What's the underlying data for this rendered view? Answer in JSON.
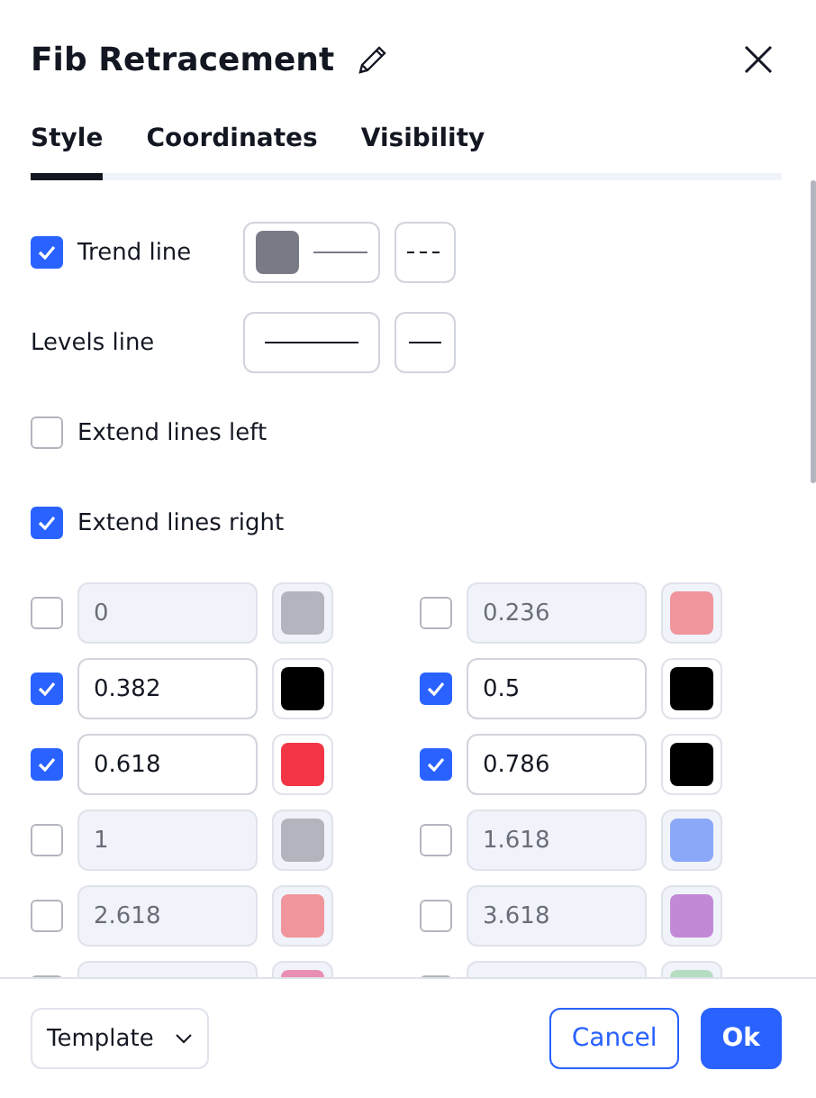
{
  "dialog": {
    "title": "Fib Retracement"
  },
  "tabs": [
    {
      "label": "Style",
      "selected": true
    },
    {
      "label": "Coordinates",
      "selected": false
    },
    {
      "label": "Visibility",
      "selected": false
    }
  ],
  "trend_line": {
    "label": "Trend line",
    "checked": true,
    "color": "#787b86"
  },
  "levels_line": {
    "label": "Levels line"
  },
  "options": [
    {
      "label": "Extend lines left",
      "checked": false
    },
    {
      "label": "Extend lines right",
      "checked": true
    }
  ],
  "levels": [
    {
      "value": "0",
      "enabled": false,
      "color": "#b2b5be"
    },
    {
      "value": "0.236",
      "enabled": false,
      "color": "#f0959c"
    },
    {
      "value": "0.382",
      "enabled": true,
      "color": "#000000"
    },
    {
      "value": "0.5",
      "enabled": true,
      "color": "#000000"
    },
    {
      "value": "0.618",
      "enabled": true,
      "color": "#f23645"
    },
    {
      "value": "0.786",
      "enabled": true,
      "color": "#000000"
    },
    {
      "value": "1",
      "enabled": false,
      "color": "#b2b5be"
    },
    {
      "value": "1.618",
      "enabled": false,
      "color": "#8ba8f8"
    },
    {
      "value": "2.618",
      "enabled": false,
      "color": "#f0959c"
    },
    {
      "value": "3.618",
      "enabled": false,
      "color": "#c28ad6"
    },
    {
      "enabled": false,
      "color": "#e98fb4"
    },
    {
      "enabled": false,
      "color": "#b6dcc1"
    }
  ],
  "footer": {
    "template": "Template",
    "buttons": [
      {
        "label": "Cancel",
        "kind": "secondary"
      },
      {
        "label": "Ok",
        "kind": "primary"
      }
    ]
  }
}
